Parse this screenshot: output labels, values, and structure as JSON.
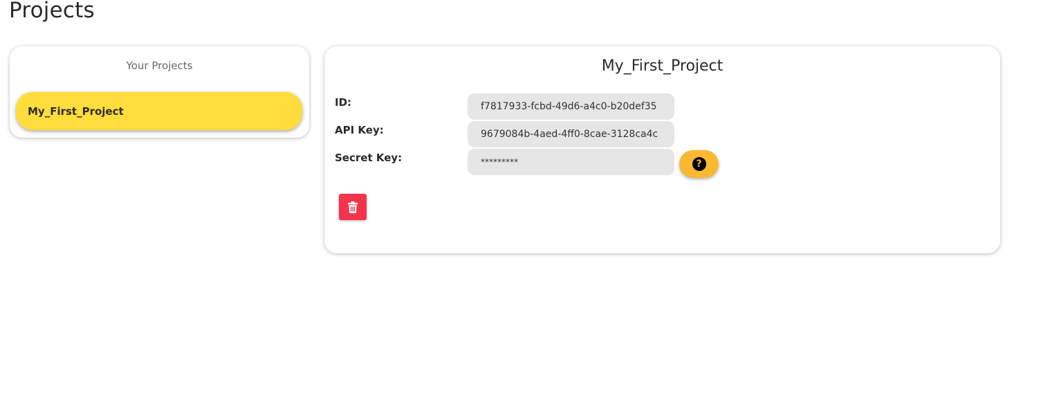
{
  "page": {
    "title": "Projects"
  },
  "sidebar": {
    "heading": "Your Projects",
    "projects": [
      {
        "label": "My_First_Project",
        "selected": true
      }
    ]
  },
  "project": {
    "name": "My_First_Project",
    "fields": {
      "id_label": "ID:",
      "id_value": "f7817933-fcbd-49d6-a4c0-b20def35",
      "api_key_label": "API Key:",
      "api_key_value": "9679084b-4aed-4ff0-8cae-3128ca4c",
      "secret_key_label": "Secret Key:",
      "secret_key_value": "*********"
    },
    "help_icon": "question-circle-icon",
    "delete_icon": "trash-icon"
  },
  "colors": {
    "selected_project": "#ffdd3c",
    "help_button": "#fbb832",
    "delete_button": "#f4344d",
    "input_background": "#e6e6e6"
  }
}
